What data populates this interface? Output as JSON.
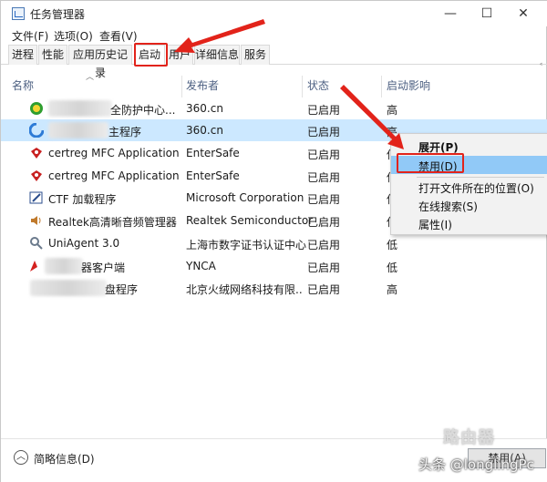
{
  "window": {
    "title": "任务管理器",
    "minimize_glyph": "—",
    "maximize_glyph": "☐",
    "close_glyph": "✕"
  },
  "menu": {
    "file": "文件(F)",
    "options": "选项(O)",
    "view": "查看(V)"
  },
  "tabs": [
    {
      "label": "进程"
    },
    {
      "label": "性能"
    },
    {
      "label": "应用历史记录"
    },
    {
      "label": "启动",
      "active": true
    },
    {
      "label": "用户"
    },
    {
      "label": "详细信息"
    },
    {
      "label": "服务"
    }
  ],
  "columns": {
    "name": "名称",
    "publisher": "发布者",
    "status": "状态",
    "impact": "启动影响"
  },
  "rows": [
    {
      "name": "全防护中心...",
      "publisher": "360.cn",
      "status": "已启用",
      "impact": "高",
      "icon": "360-shield-icon"
    },
    {
      "name": "主程序",
      "publisher": "360.cn",
      "status": "已启用",
      "impact": "高",
      "icon": "360-browser-icon",
      "selected": true
    },
    {
      "name": "certreg MFC Application",
      "publisher": "EnterSafe",
      "status": "已启用",
      "impact": "低",
      "icon": "certreg-icon"
    },
    {
      "name": "certreg MFC Application",
      "publisher": "EnterSafe",
      "status": "已启用",
      "impact": "低",
      "icon": "certreg-icon"
    },
    {
      "name": "CTF 加载程序",
      "publisher": "Microsoft Corporation",
      "status": "已启用",
      "impact": "低",
      "icon": "ctf-loader-icon"
    },
    {
      "name": "Realtek高清晰音频管理器",
      "publisher": "Realtek Semiconductor",
      "status": "已启用",
      "impact": "低",
      "icon": "speaker-icon"
    },
    {
      "name": "UniAgent 3.0",
      "publisher": "上海市数字证书认证中心",
      "status": "已启用",
      "impact": "低",
      "icon": "uniagent-icon"
    },
    {
      "name": "器客户端",
      "publisher": "YNCA",
      "status": "已启用",
      "impact": "低",
      "icon": "ynca-icon"
    },
    {
      "name": "盘程序",
      "publisher": "北京火绒网络科技有限...",
      "status": "已启用",
      "impact": "高",
      "icon": "disk-program-icon"
    }
  ],
  "context_menu": {
    "expand": "展开(P)",
    "disable": "禁用(D)",
    "open_location": "打开文件所在的位置(O)",
    "search_online": "在线搜索(S)",
    "properties": "属性(I)"
  },
  "footer": {
    "fewer_details": "简略信息(D)",
    "disable_button": "禁用(A)"
  },
  "watermark": {
    "brand": "路由器",
    "author": "头条 @longlingPc"
  },
  "colors": {
    "selection": "#cce8ff",
    "menu_highlight": "#91c9f7",
    "annotation_red": "#e2231a",
    "header_text": "#4d6082"
  }
}
